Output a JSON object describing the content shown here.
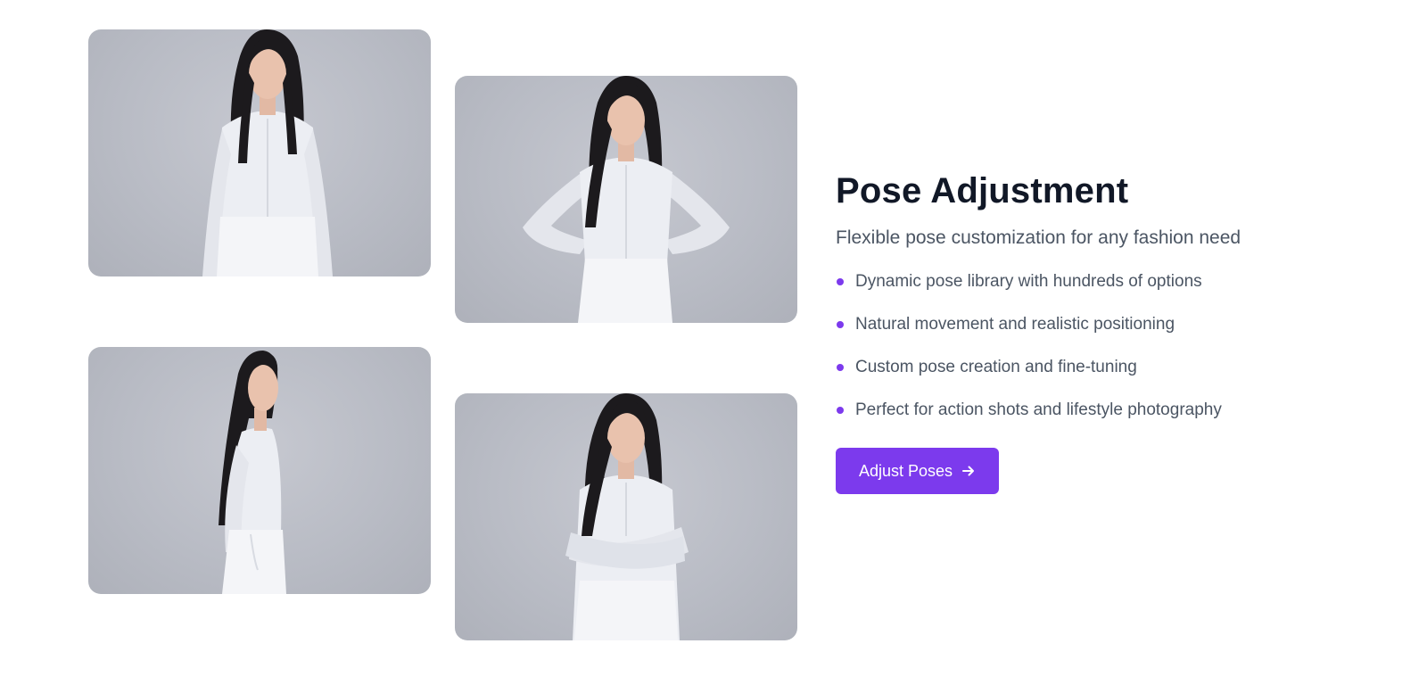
{
  "section": {
    "title": "Pose Adjustment",
    "subtitle": "Flexible pose customization for any fashion need",
    "features": [
      "Dynamic pose library with hundreds of options",
      "Natural movement and realistic positioning",
      "Custom pose creation and fine-tuning",
      "Perfect for action shots and lifestyle photography"
    ],
    "cta": {
      "label": "Adjust Poses",
      "icon": "arrow-right-icon"
    }
  },
  "gallery": {
    "images": [
      {
        "pose": "standing-arms-down"
      },
      {
        "pose": "hands-on-hips"
      },
      {
        "pose": "side-profile-hand-in-pocket"
      },
      {
        "pose": "arms-crossed"
      }
    ]
  },
  "colors": {
    "accent": "#7c3aed",
    "heading": "#111827",
    "body_text": "#4b5563",
    "photo_background": "#b9bcc5"
  }
}
